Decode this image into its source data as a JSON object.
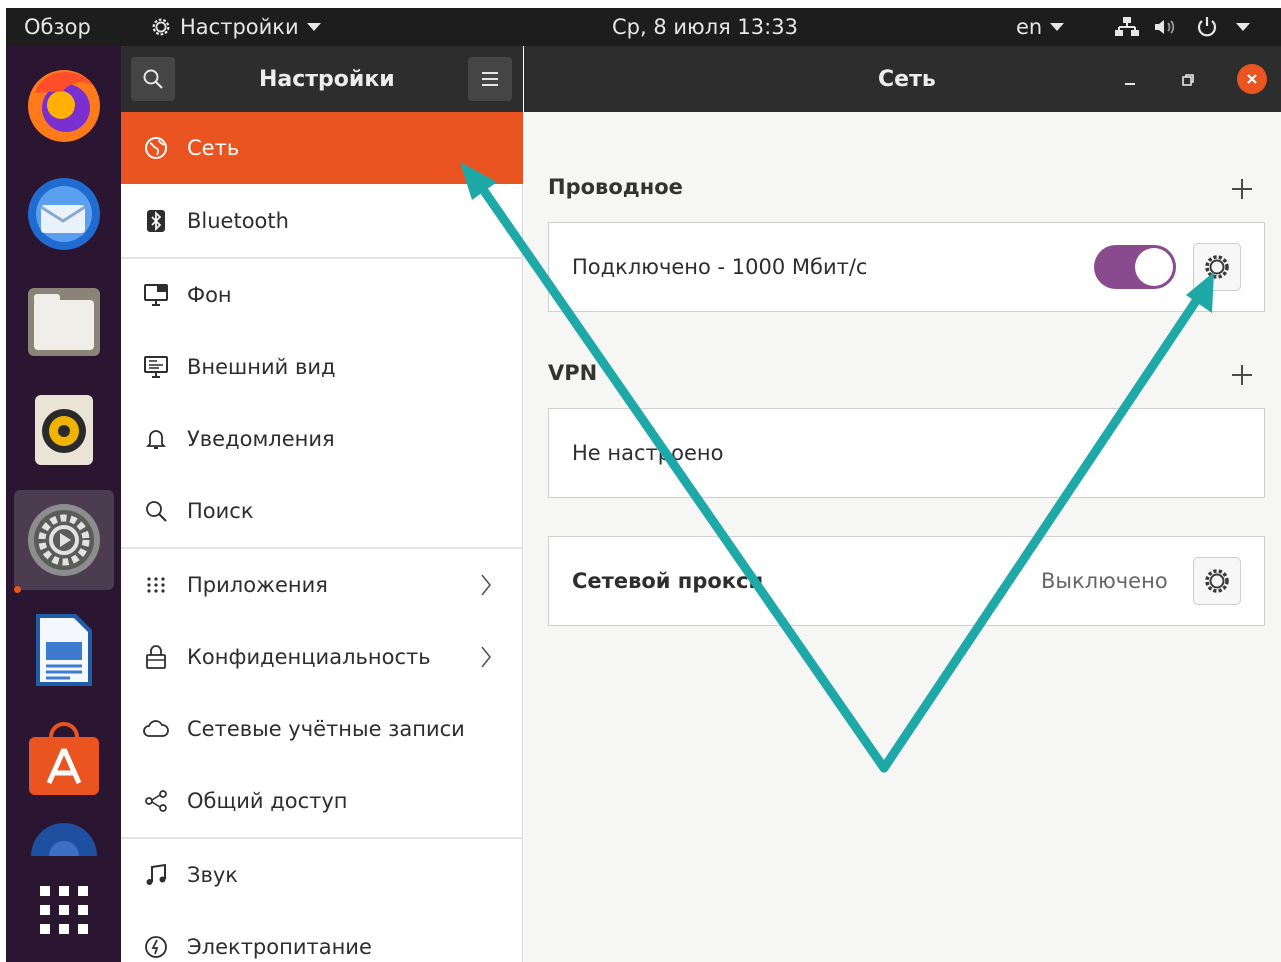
{
  "topbar": {
    "activities": "Обзор",
    "app_menu": "Настройки",
    "clock": "Ср, 8 июля  13:33",
    "keyboard_layout": "en"
  },
  "dock": {
    "items": [
      "firefox-icon",
      "thunderbird-icon",
      "files-icon",
      "rhythmbox-icon",
      "settings-icon",
      "libreoffice-writer-icon",
      "software-icon",
      "partial-app-icon"
    ],
    "show_apps": "show-apps-icon"
  },
  "window": {
    "sidebar_title": "Настройки",
    "main_title": "Сеть"
  },
  "sidebar": {
    "items": [
      {
        "label": "Сеть",
        "icon": "globe-icon"
      },
      {
        "label": "Bluetooth",
        "icon": "bluetooth-icon"
      },
      {
        "label": "Фон",
        "icon": "monitor-icon"
      },
      {
        "label": "Внешний вид",
        "icon": "appearance-icon"
      },
      {
        "label": "Уведомления",
        "icon": "bell-icon"
      },
      {
        "label": "Поиск",
        "icon": "search-icon"
      },
      {
        "label": "Приложения",
        "icon": "apps-grid-icon"
      },
      {
        "label": "Конфиденциальность",
        "icon": "lock-icon"
      },
      {
        "label": "Сетевые учётные записи",
        "icon": "cloud-icon"
      },
      {
        "label": "Общий доступ",
        "icon": "share-icon"
      },
      {
        "label": "Звук",
        "icon": "music-note-icon"
      },
      {
        "label": "Электропитание",
        "icon": "power-icon"
      }
    ]
  },
  "main": {
    "wired": {
      "title": "Проводное",
      "status": "Подключено - 1000 Мбит/с",
      "enabled": true
    },
    "vpn": {
      "title": "VPN",
      "status": "Не настроено"
    },
    "proxy": {
      "title": "Сетевой прокси",
      "status": "Выключено"
    }
  },
  "colors": {
    "accent": "#e95420",
    "toggle_on": "#8a4a8e",
    "annotation_arrow": "#1fa8a8",
    "dock_bg": "#2a1630",
    "header_bg": "#2d2d2d"
  }
}
